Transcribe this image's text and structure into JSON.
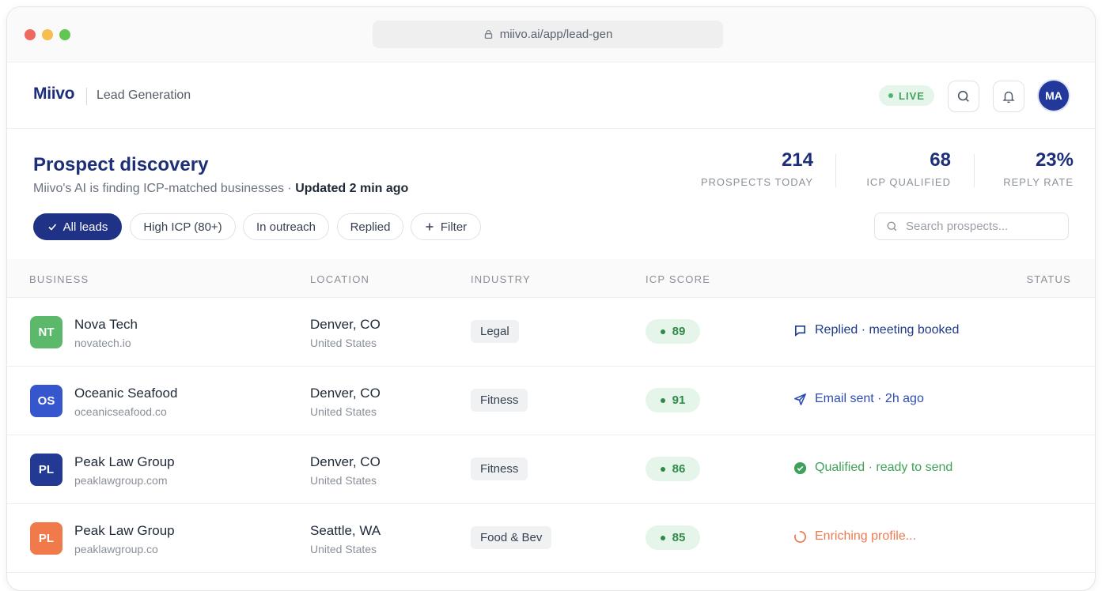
{
  "browser": {
    "url": "miivo.ai/app/lead-gen"
  },
  "header": {
    "logo": "Miivo",
    "section": "Lead Generation",
    "live_label": "LIVE",
    "avatar_initials": "MA"
  },
  "page": {
    "title": "Prospect discovery",
    "subtitle": "Miivo's AI is finding ICP-matched businesses · ",
    "updated": "Updated 2 min ago"
  },
  "stats": [
    {
      "value": "214",
      "label": "PROSPECTS TODAY"
    },
    {
      "value": "68",
      "label": "ICP QUALIFIED"
    },
    {
      "value": "23%",
      "label": "REPLY RATE"
    }
  ],
  "filters": {
    "all_leads": "All leads",
    "high_icp": "High ICP (80+)",
    "in_outreach": "In outreach",
    "replied": "Replied",
    "filter": "Filter"
  },
  "search": {
    "placeholder": "Search prospects..."
  },
  "columns": {
    "business": "BUSINESS",
    "location": "LOCATION",
    "industry": "INDUSTRY",
    "icp_score": "ICP SCORE",
    "status": "STATUS"
  },
  "rows": [
    {
      "initials": "NT",
      "avatar_color": "#5cb86b",
      "name": "Nova Tech",
      "domain": "novatech.io",
      "city": "Denver, CO",
      "country": "United States",
      "industry": "Legal",
      "score": "89",
      "status": "Replied · meeting booked",
      "status_color": "#1e3a8a",
      "status_icon": "chat-bubble-icon"
    },
    {
      "initials": "OS",
      "avatar_color": "#3556cc",
      "name": "Oceanic Seafood",
      "domain": "oceanicseafood.co",
      "city": "Denver, CO",
      "country": "United States",
      "industry": "Fitness",
      "score": "91",
      "status": "Email sent · 2h ago",
      "status_color": "#2e4bb5",
      "status_icon": "send-icon"
    },
    {
      "initials": "PL",
      "avatar_color": "#223a94",
      "name": "Peak Law Group",
      "domain": "peaklawgroup.com",
      "city": "Denver, CO",
      "country": "United States",
      "industry": "Fitness",
      "score": "86",
      "status": "Qualified · ready to send",
      "status_color": "#3fa15a",
      "status_icon": "check-circle-icon"
    },
    {
      "initials": "PL",
      "avatar_color": "#f07a4a",
      "name": "Peak Law Group",
      "domain": "peaklawgroup.co",
      "city": "Seattle, WA",
      "country": "United States",
      "industry": "Food & Bev",
      "score": "85",
      "status": "Enriching profile...",
      "status_color": "#ef7a50",
      "status_icon": "spinner-icon"
    }
  ]
}
